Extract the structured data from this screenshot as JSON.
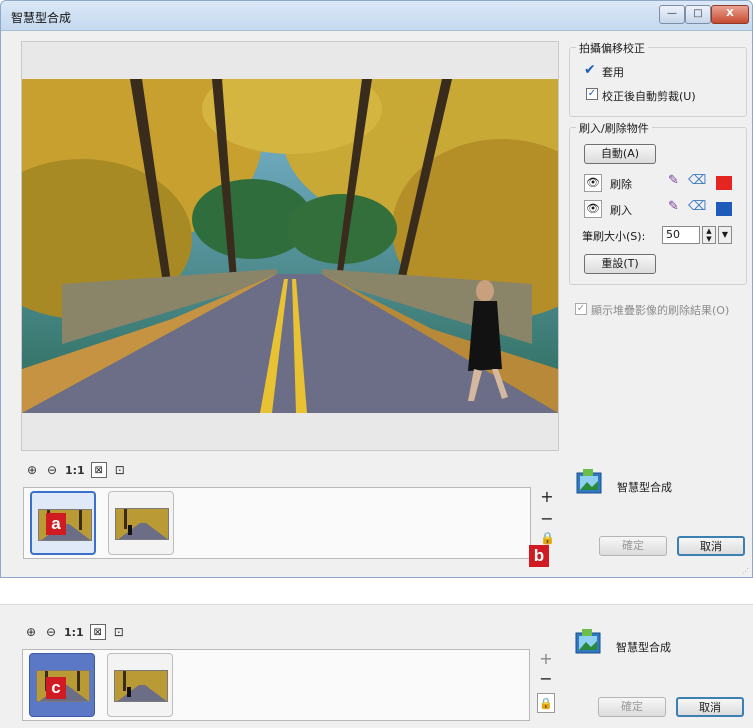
{
  "window": {
    "title": "智慧型合成",
    "controls": {
      "minimize": "—",
      "maximize": "□",
      "close": "X"
    }
  },
  "zoom_toolbar": {
    "zoom_in": "⊕",
    "zoom_out": "⊖",
    "one_to_one": "1:1",
    "fit_icon": "⊠",
    "move_icon": "⊡"
  },
  "thumbnails": {
    "badge_a": "a",
    "badge_b": "b",
    "badge_c": "c",
    "add": "+",
    "remove": "−"
  },
  "skew_group": {
    "title": "拍攝偏移校正",
    "apply_label": "套用",
    "auto_crop_label": "校正後自動剪裁(U)",
    "auto_crop_checked": true
  },
  "brush_group": {
    "title": "刷入/刷除物件",
    "auto_button": "自動(A)",
    "remove_label": "刷除",
    "add_label": "刷入",
    "brush_size_label": "筆刷大小(S):",
    "brush_size_value": "50",
    "reset_button": "重設(T)",
    "remove_color": "#e52521",
    "add_color": "#1f5bb8"
  },
  "overlay_option": {
    "label": "顯示堆疊影像的刷除結果(O)",
    "checked": true
  },
  "app": {
    "name": "智慧型合成"
  },
  "buttons": {
    "ok": "確定",
    "cancel": "取消"
  }
}
